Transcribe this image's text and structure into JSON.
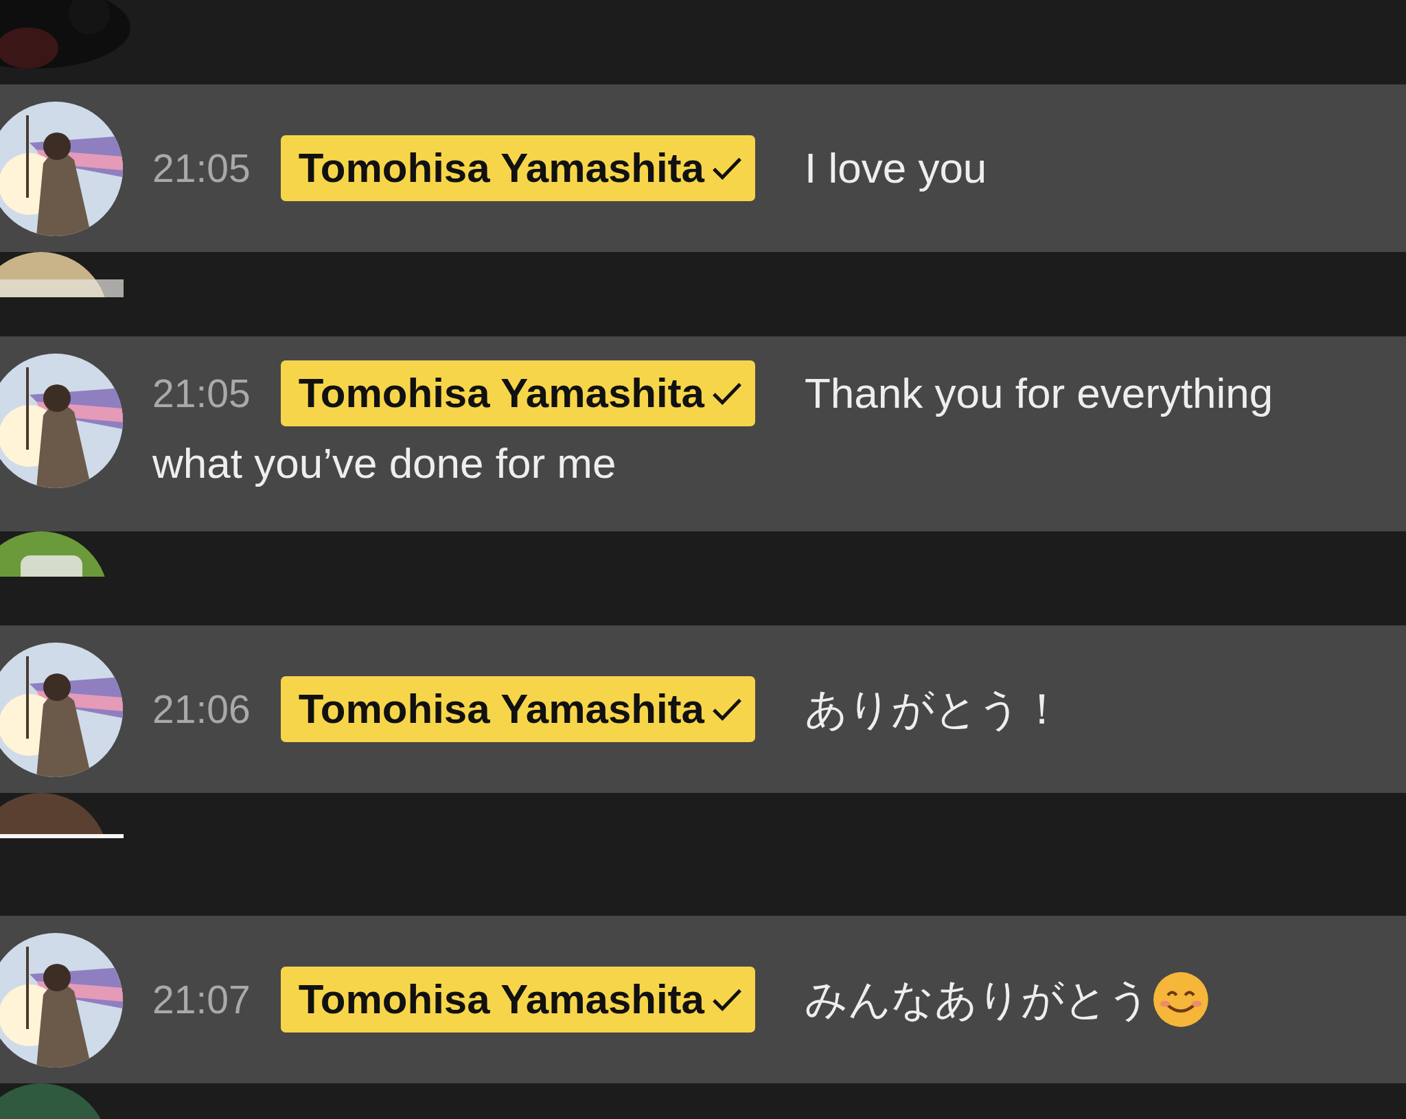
{
  "chat": [
    {
      "kind": "cut"
    },
    {
      "kind": "message",
      "time": "21:05",
      "author": "Tomohisa Yamashita",
      "verified": true,
      "lines": [
        "I love you"
      ],
      "emoji": false
    },
    {
      "kind": "cut"
    },
    {
      "kind": "message",
      "time": "21:05",
      "author": "Tomohisa Yamashita",
      "verified": true,
      "lines": [
        "Thank you for everything",
        "what you’ve done for me"
      ],
      "emoji": false
    },
    {
      "kind": "cut"
    },
    {
      "kind": "message",
      "time": "21:06",
      "author": "Tomohisa Yamashita",
      "verified": true,
      "lines": [
        "ありがとう！"
      ],
      "emoji": false
    },
    {
      "kind": "cut"
    },
    {
      "kind": "message",
      "time": "21:07",
      "author": "Tomohisa Yamashita",
      "verified": true,
      "lines": [
        "みんなありがとう"
      ],
      "emoji": true
    },
    {
      "kind": "cut"
    }
  ]
}
